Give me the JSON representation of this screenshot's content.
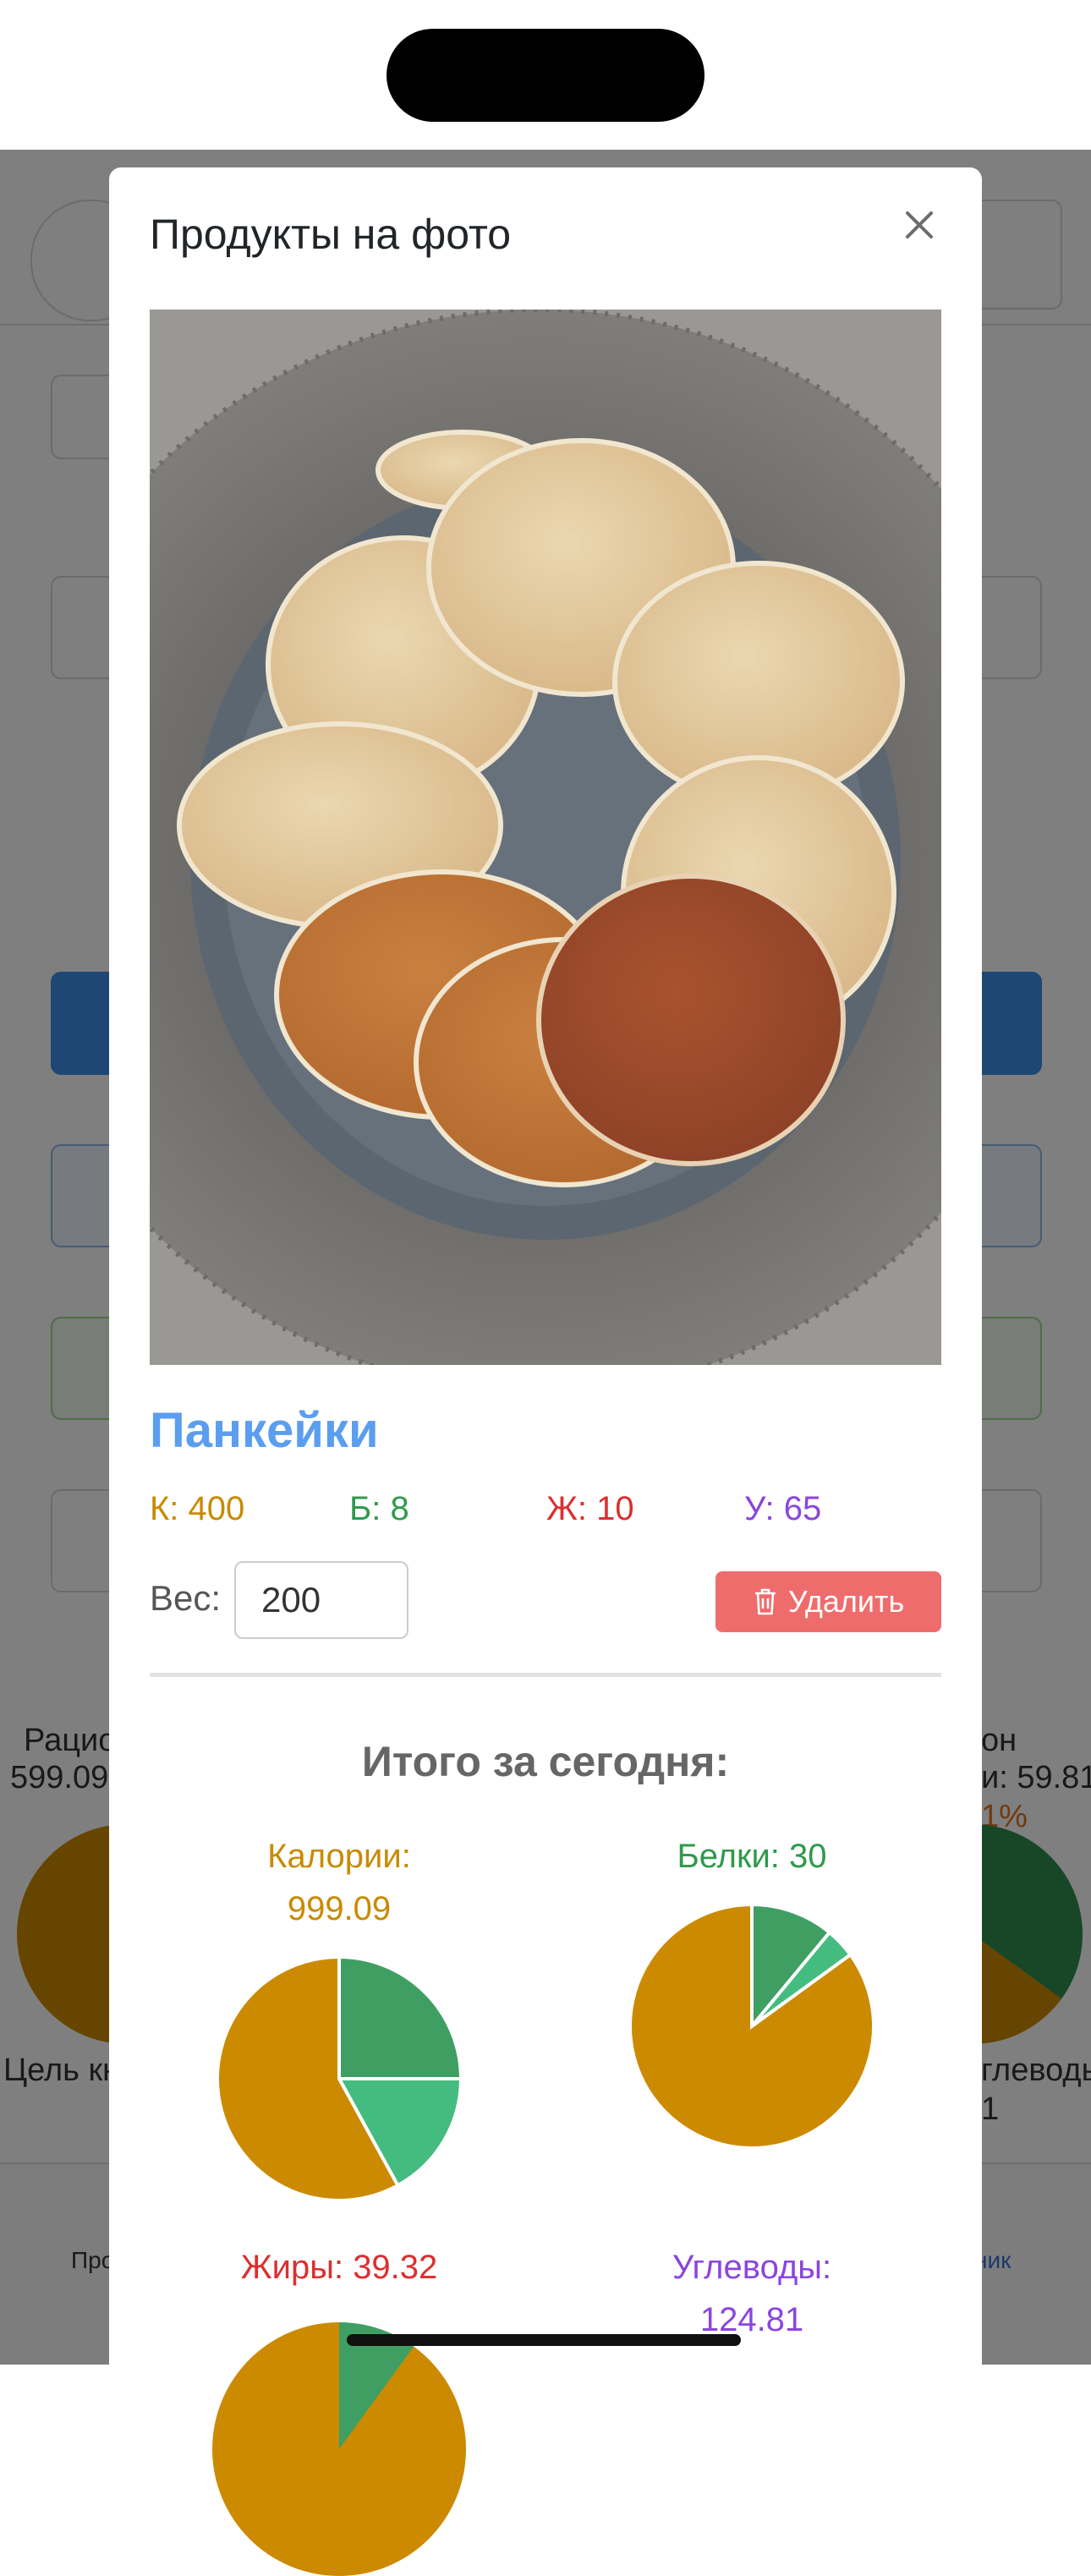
{
  "modal": {
    "title": "Продукты на фото",
    "product": {
      "name": "Панкейки",
      "macros": {
        "kcal": "К: 400",
        "protein": "Б: 8",
        "fat": "Ж: 10",
        "carbs": "У: 65"
      },
      "weight_label": "Вес:",
      "weight_value": "200",
      "delete_label": "Удалить"
    },
    "totals": {
      "title": "Итого за сегодня:",
      "items": [
        {
          "label_line1": "Калории:",
          "label_line2": "999.09"
        },
        {
          "label_line1": "Белки: 30",
          "label_line2": ""
        },
        {
          "label_line1": "Жиры: 39.32",
          "label_line2": ""
        },
        {
          "label_line1": "Углеводы:",
          "label_line2": "124.81"
        }
      ]
    }
  },
  "background": {
    "left_title": "Рацио",
    "left_value": "599.09",
    "left_goal": "Цель кк",
    "right_title": "он",
    "right_value": "и: 59.81",
    "right_pct": "1%",
    "right_goal": "глеводы:",
    "right_goal_value": "1",
    "nav_left": "Про",
    "nav_right": "ник"
  },
  "colors": {
    "calories": "#c98a02",
    "protein": "#2f9a4c",
    "fat": "#dc2f2f",
    "carbs": "#8b45e0",
    "title_blue": "#5b9ef0",
    "delete_red": "#ef6c6c",
    "pie_gold": "#cc8a00",
    "pie_green": "#3f9f63",
    "pie_light_green": "#44bc80"
  },
  "chart_data": [
    {
      "type": "pie",
      "title": "Калории: 999.09",
      "slices": [
        {
          "value": 0.25
        },
        {
          "value": 0.17
        },
        {
          "value": 0.58
        }
      ]
    },
    {
      "type": "pie",
      "title": "Белки: 30",
      "slices": [
        {
          "value": 0.11
        },
        {
          "value": 0.04
        },
        {
          "value": 0.85
        }
      ]
    }
  ]
}
